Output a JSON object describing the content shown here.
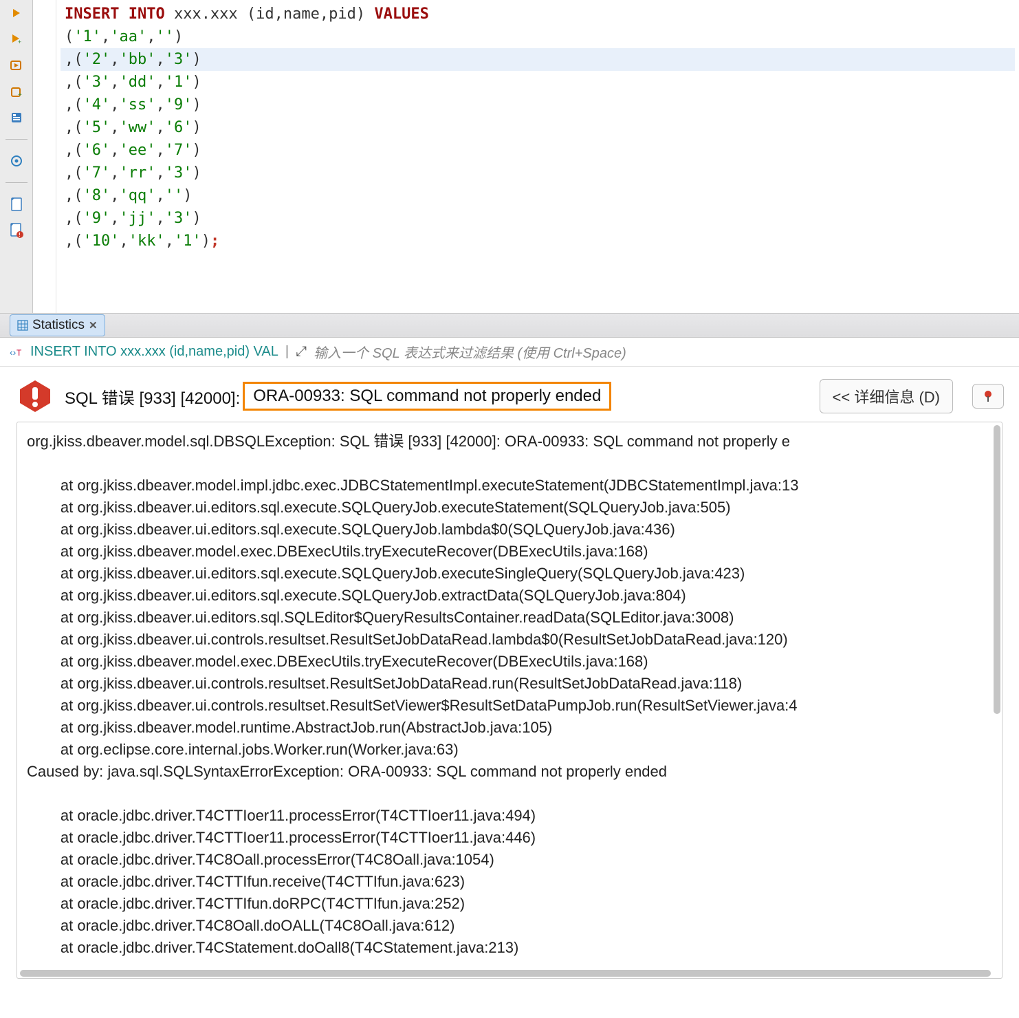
{
  "sql": {
    "keyword_insert_into": "INSERT INTO",
    "table": "xxx.xxx",
    "columns": "(id,name,pid)",
    "keyword_values": "VALUES",
    "rows": [
      "('1','aa','')",
      ",('2','bb','3')",
      ",('3','dd','1')",
      ",('4','ss','9')",
      ",('5','ww','6')",
      ",('6','ee','7')",
      ",('7','rr','3')",
      ",('8','qq','')",
      ",('9','jj','3')",
      ",('10','kk','1')"
    ],
    "terminator": ";",
    "highlighted_row_index": 1
  },
  "tab": {
    "label": "Statistics"
  },
  "filter": {
    "statement_preview": "INSERT INTO xxx.xxx (id,name,pid) VAL",
    "placeholder": "输入一个 SQL 表达式来过滤结果 (使用 Ctrl+Space)"
  },
  "error": {
    "prefix": "SQL 错误 [933] [42000]:",
    "highlight": "ORA-00933: SQL command not properly ended",
    "details_button": "<< 详细信息 (D)",
    "stack_trace": "org.jkiss.dbeaver.model.sql.DBSQLException: SQL 错误 [933] [42000]: ORA-00933: SQL command not properly e\n\n\tat org.jkiss.dbeaver.model.impl.jdbc.exec.JDBCStatementImpl.executeStatement(JDBCStatementImpl.java:13\n\tat org.jkiss.dbeaver.ui.editors.sql.execute.SQLQueryJob.executeStatement(SQLQueryJob.java:505)\n\tat org.jkiss.dbeaver.ui.editors.sql.execute.SQLQueryJob.lambda$0(SQLQueryJob.java:436)\n\tat org.jkiss.dbeaver.model.exec.DBExecUtils.tryExecuteRecover(DBExecUtils.java:168)\n\tat org.jkiss.dbeaver.ui.editors.sql.execute.SQLQueryJob.executeSingleQuery(SQLQueryJob.java:423)\n\tat org.jkiss.dbeaver.ui.editors.sql.execute.SQLQueryJob.extractData(SQLQueryJob.java:804)\n\tat org.jkiss.dbeaver.ui.editors.sql.SQLEditor$QueryResultsContainer.readData(SQLEditor.java:3008)\n\tat org.jkiss.dbeaver.ui.controls.resultset.ResultSetJobDataRead.lambda$0(ResultSetJobDataRead.java:120)\n\tat org.jkiss.dbeaver.model.exec.DBExecUtils.tryExecuteRecover(DBExecUtils.java:168)\n\tat org.jkiss.dbeaver.ui.controls.resultset.ResultSetJobDataRead.run(ResultSetJobDataRead.java:118)\n\tat org.jkiss.dbeaver.ui.controls.resultset.ResultSetViewer$ResultSetDataPumpJob.run(ResultSetViewer.java:4\n\tat org.jkiss.dbeaver.model.runtime.AbstractJob.run(AbstractJob.java:105)\n\tat org.eclipse.core.internal.jobs.Worker.run(Worker.java:63)\nCaused by: java.sql.SQLSyntaxErrorException: ORA-00933: SQL command not properly ended\n\n\tat oracle.jdbc.driver.T4CTTIoer11.processError(T4CTTIoer11.java:494)\n\tat oracle.jdbc.driver.T4CTTIoer11.processError(T4CTTIoer11.java:446)\n\tat oracle.jdbc.driver.T4C8Oall.processError(T4C8Oall.java:1054)\n\tat oracle.jdbc.driver.T4CTTIfun.receive(T4CTTIfun.java:623)\n\tat oracle.jdbc.driver.T4CTTIfun.doRPC(T4CTTIfun.java:252)\n\tat oracle.jdbc.driver.T4C8Oall.doOALL(T4C8Oall.java:612)\n\tat oracle.jdbc.driver.T4CStatement.doOall8(T4CStatement.java:213)"
  },
  "toolbar_icons": [
    "execute-icon",
    "execute-script-icon",
    "execute-new-tab-icon",
    "export-icon",
    "import-icon",
    "explain-plan-icon",
    "settings-icon",
    "save-icon",
    "save-error-icon"
  ]
}
